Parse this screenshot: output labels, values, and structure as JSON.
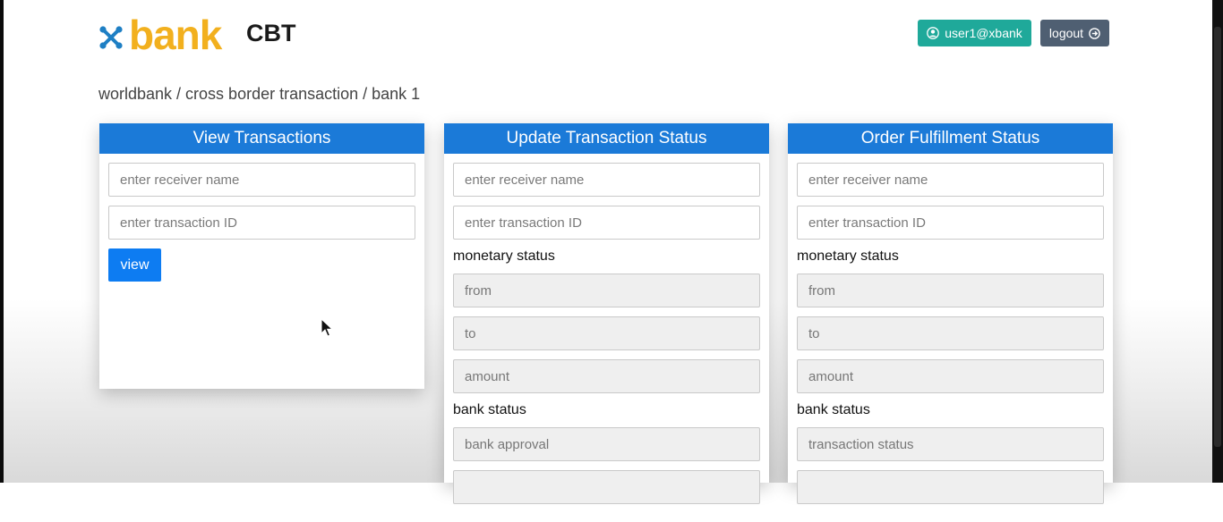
{
  "header": {
    "logo_text": "bank",
    "app_name": "CBT",
    "user_label": "user1@xbank",
    "logout_label": "logout",
    "icons": {
      "user": "user-circle-icon",
      "logout": "logout-circle-arrow-icon",
      "logo_mark": "x-logo-icon"
    }
  },
  "breadcrumb": "worldbank / cross border transaction / bank 1",
  "panels": {
    "view": {
      "title": "View Transactions",
      "receiver_placeholder": "enter receiver name",
      "txid_placeholder": "enter transaction ID",
      "view_label": "view"
    },
    "update": {
      "title": "Update Transaction Status",
      "receiver_placeholder": "enter receiver name",
      "txid_placeholder": "enter transaction ID",
      "monetary_label": "monetary status",
      "from_placeholder": "from",
      "to_placeholder": "to",
      "amount_placeholder": "amount",
      "bank_label": "bank status",
      "approval_placeholder": "bank approval"
    },
    "order": {
      "title": "Order Fulfillment Status",
      "receiver_placeholder": "enter receiver name",
      "txid_placeholder": "enter transaction ID",
      "monetary_label": "monetary status",
      "from_placeholder": "from",
      "to_placeholder": "to",
      "amount_placeholder": "amount",
      "bank_label": "bank status",
      "status_placeholder": "transaction status"
    }
  },
  "colors": {
    "brand_yellow": "#f2b01e",
    "logo_blue": "#1e7fc4",
    "panel_header": "#1b7ad8",
    "user_button": "#1fa99a",
    "logout_button": "#4f5f72",
    "primary_button": "#0d7cf2"
  }
}
